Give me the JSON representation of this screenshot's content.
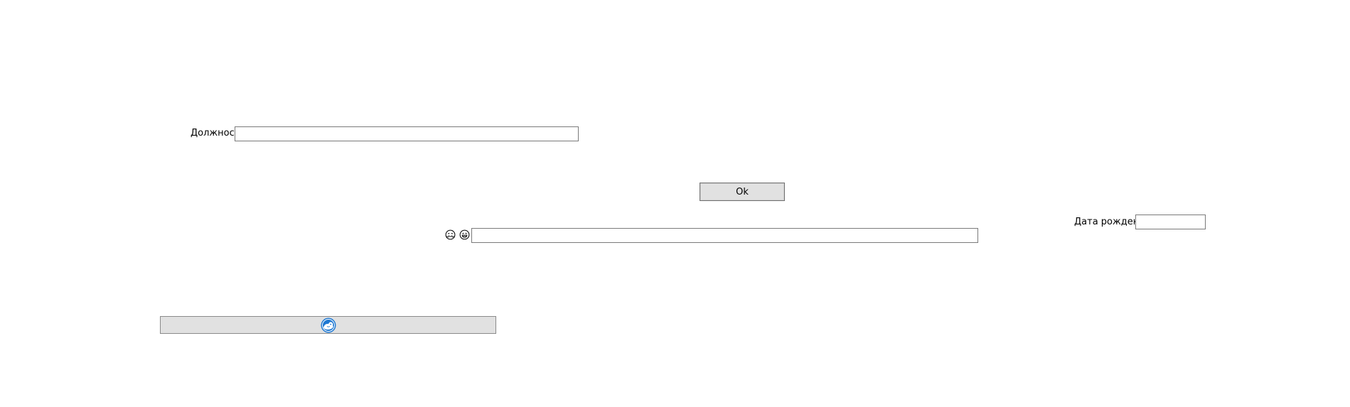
{
  "form": {
    "position_label": "Должность",
    "position_value": "",
    "ok_button_label": "Ok",
    "birthdate_label": "Дата рождения",
    "birthdate_value": "",
    "chat_input_value": ""
  },
  "icons": {
    "emoji_1": "hugging-face-icon",
    "emoji_2": "grinning-face-icon",
    "image_button_icon": "blue-mascot-icon"
  },
  "colors": {
    "button_face": "#e1e1e1",
    "button_border": "#adadad",
    "input_border": "#7a7a7a",
    "icon_blue": "#1e78d2"
  }
}
